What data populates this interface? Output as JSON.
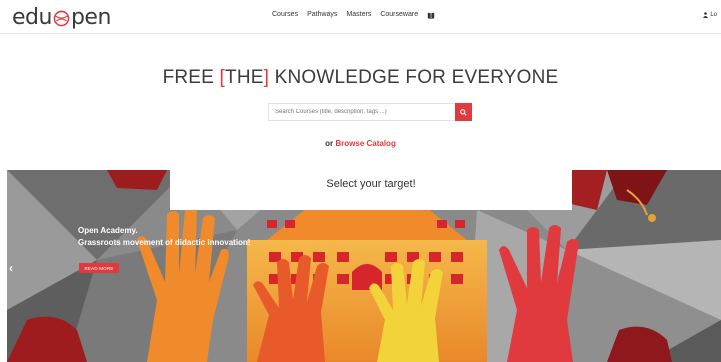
{
  "header": {
    "logo_left": "edu",
    "logo_right": "pen",
    "nav": [
      "Courses",
      "Pathways",
      "Masters",
      "Courseware"
    ],
    "login": "Lo"
  },
  "hero": {
    "headline_pre": "FREE ",
    "bracket_open": "[",
    "headline_mid": "THE",
    "bracket_close": "]",
    "headline_post": " KNOWLEDGE FOR EVERYONE",
    "search_placeholder": "Search Courses (title, description, tags ...)",
    "browse_prefix": "or ",
    "browse_link": "Browse Catalog"
  },
  "banner": {
    "title_line1": "Open Academy.",
    "title_line2": "Grassroots movement of didactic innovation!",
    "read_more": "READ MORE",
    "prev_arrow": "‹"
  },
  "target": {
    "label": "Select your target!"
  },
  "colors": {
    "accent": "#e03a3e",
    "orange": "#f08a2a",
    "yellow": "#f2d43a"
  }
}
